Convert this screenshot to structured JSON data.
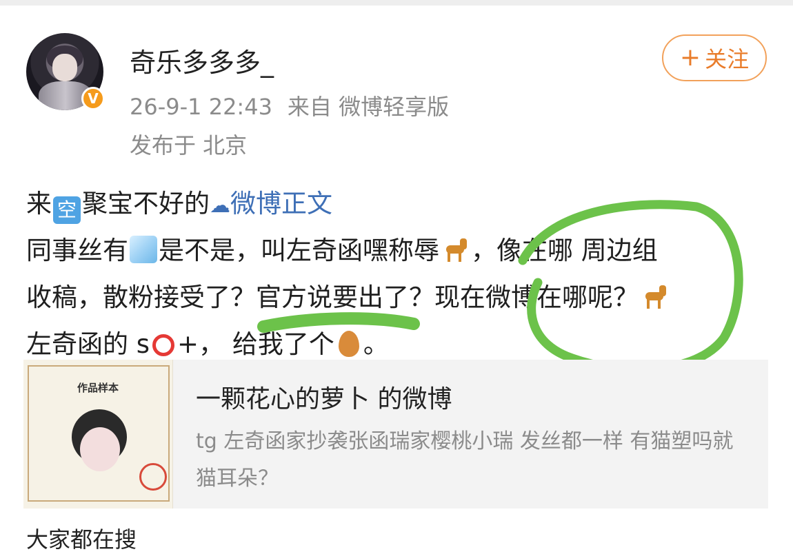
{
  "post": {
    "author": {
      "name": "奇乐多多多_",
      "verified_badge": "V",
      "avatar": "avatar-photo"
    },
    "meta": {
      "time": "26-9-1 22:43",
      "source": "来自 微博轻享版",
      "location": "发布于 北京"
    },
    "follow_button": {
      "icon": "plus-icon",
      "label": "关注"
    },
    "content": {
      "line1": {
        "t1": "来",
        "emoji_box": "空",
        "t2": "聚宝不好的",
        "link_icon": "cloud-icon",
        "link": "微博正文"
      },
      "line2": {
        "t1": "同事丝有",
        "t2": "是不是，叫左奇函嘿称辱",
        "t3": "，像在哪 周边组"
      },
      "line3": {
        "t1": "收稿，散粉接受了？官方说要出了？现在微博在哪呢？"
      },
      "line4": {
        "t1": "左奇函的 s",
        "t2": "+，",
        "t3": "给我了个",
        "t4": "。"
      }
    },
    "repost_card": {
      "thumb_title": "作品样本",
      "title": "一颗花心的萝卜 的微博",
      "description": "tg 左奇函家抄袭张函瑞家樱桃小瑞 发丝都一样 有猫塑吗就猫耳朵？"
    },
    "next_text": "大家都在搜"
  },
  "colors": {
    "accent": "#e97c2a",
    "link": "#3e6fb6",
    "annotation": "#6cc24a"
  }
}
